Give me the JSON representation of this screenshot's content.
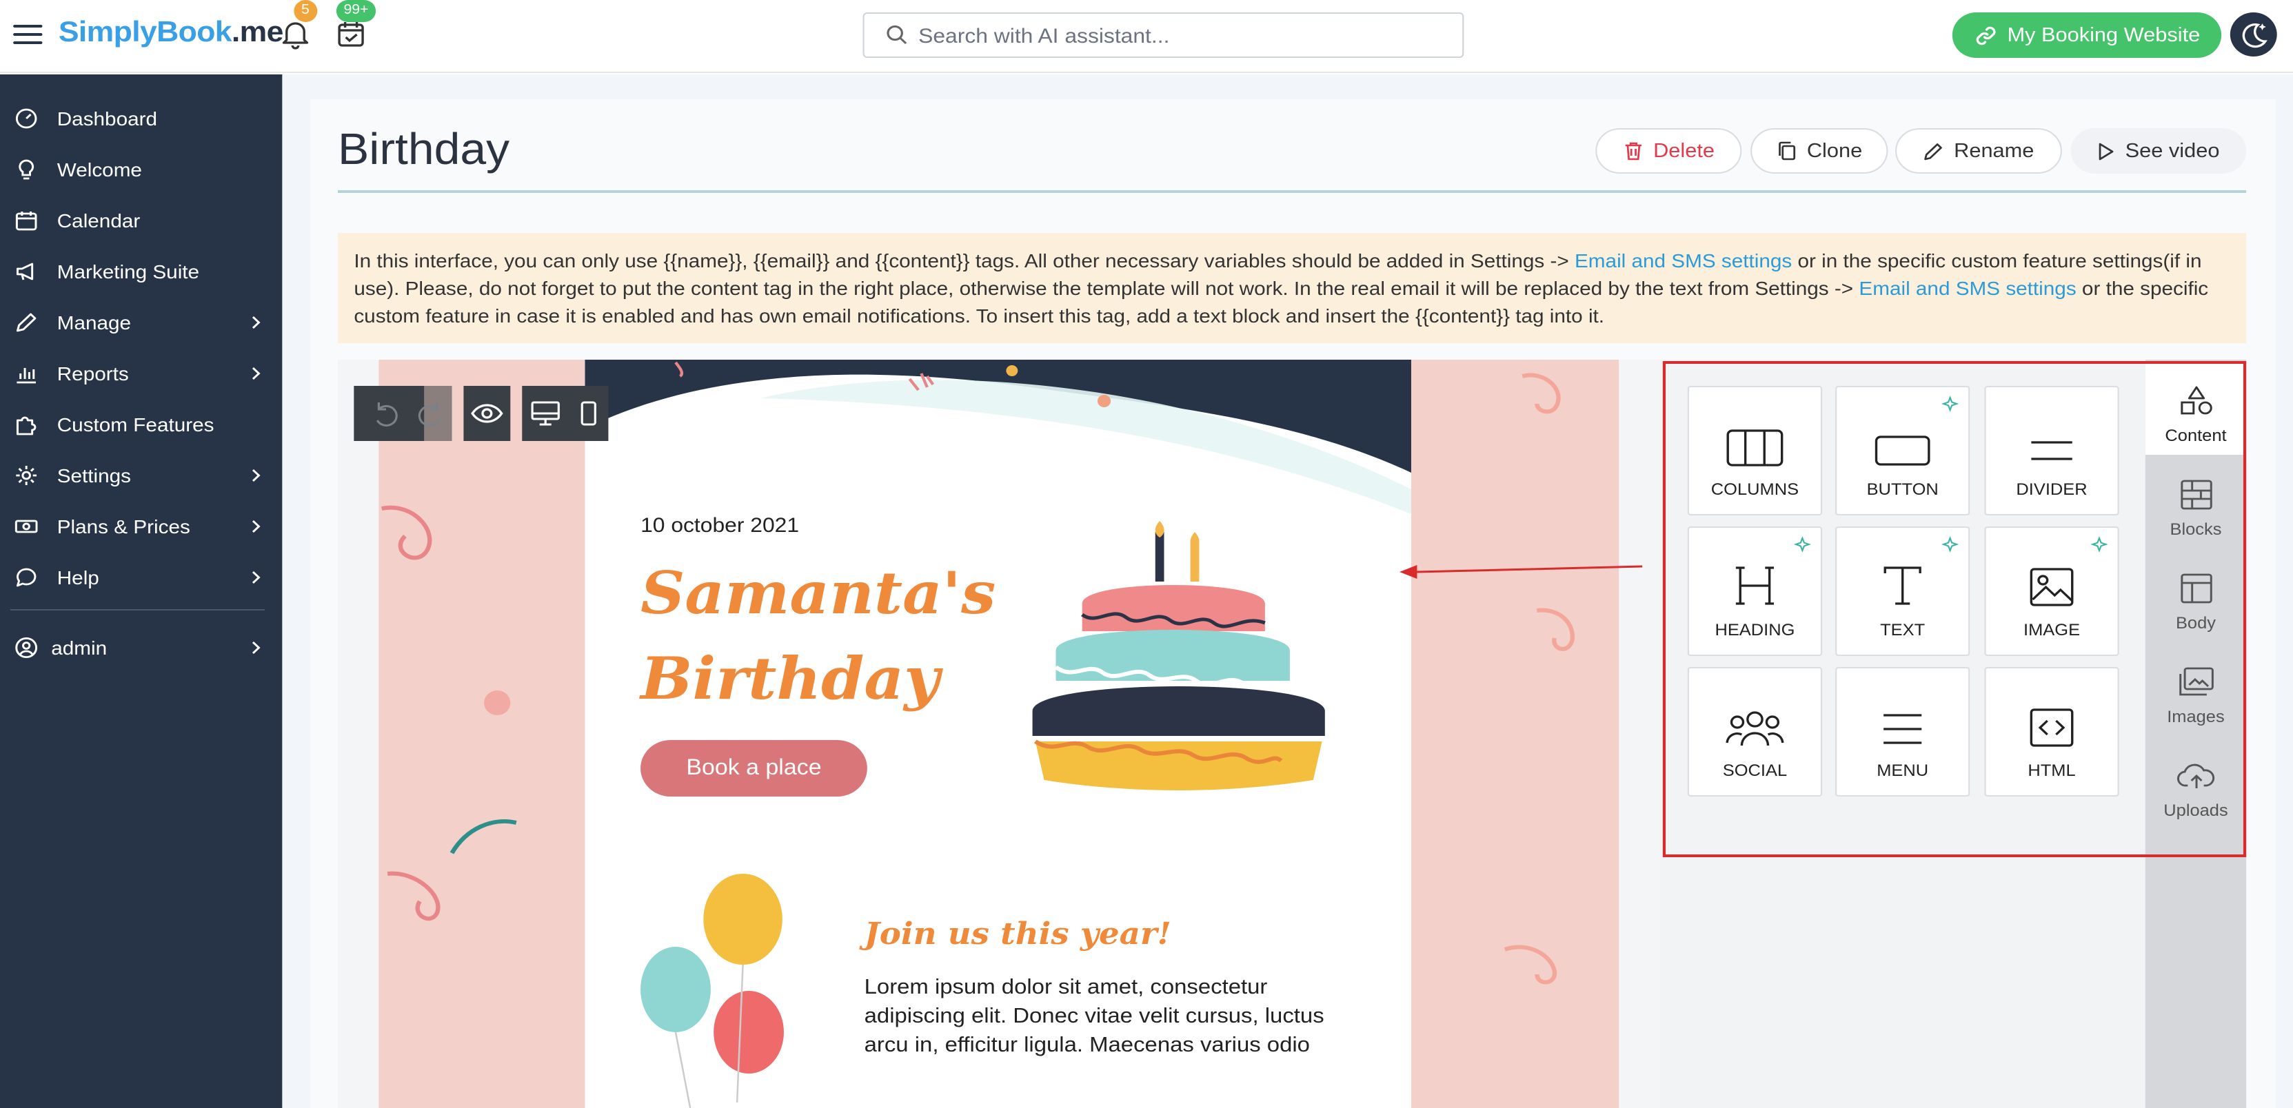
{
  "app": {
    "logo_main": "SimplyBook",
    "logo_suffix": ".me",
    "notifications_count": "5",
    "bookings_count": "99+",
    "search_placeholder": "Search with AI assistant...",
    "my_booking_website": "My Booking Website"
  },
  "sidebar": {
    "items": [
      {
        "label": "Dashboard",
        "icon": "dashboard-icon"
      },
      {
        "label": "Welcome",
        "icon": "bulb-icon"
      },
      {
        "label": "Calendar",
        "icon": "calendar-icon"
      },
      {
        "label": "Marketing Suite",
        "icon": "megaphone-icon"
      },
      {
        "label": "Manage",
        "icon": "pencil-icon"
      },
      {
        "label": "Reports",
        "icon": "bar-chart-icon"
      },
      {
        "label": "Custom Features",
        "icon": "puzzle-icon"
      },
      {
        "label": "Settings",
        "icon": "gear-icon"
      },
      {
        "label": "Plans & Prices",
        "icon": "money-icon"
      },
      {
        "label": "Help",
        "icon": "chat-icon"
      }
    ],
    "user": "admin"
  },
  "page": {
    "title": "Birthday",
    "actions": {
      "delete": "Delete",
      "clone": "Clone",
      "rename": "Rename",
      "video": "See video"
    },
    "info": {
      "p1": "In this interface, you can only use {{name}}, {{email}} and {{content}} tags. All other necessary variables should be added in Settings -> ",
      "link1": "Email and SMS settings",
      "p2": " or in the specific custom feature settings(if in use). Please, do not forget to put the content tag in the right place, otherwise the template will not work. In the real email it will be replaced by the text from Settings -> ",
      "link2": "Email and SMS settings",
      "p3": " or the specific custom feature in case it is enabled and has own email notifications. To insert this tag, add a text block and insert the {{content}} tag into it."
    }
  },
  "email": {
    "date": "10 october 2021",
    "heading_line1": "Samanta's",
    "heading_line2": "Birthday",
    "button": "Book a place",
    "join": "Join us this year!",
    "body": "Lorem ipsum dolor sit amet, consectetur adipiscing elit. Donec vitae velit cursus, luctus arcu in, efficitur ligula. Maecenas varius odio"
  },
  "builder": {
    "tools": [
      {
        "label": "COLUMNS",
        "ai": false
      },
      {
        "label": "BUTTON",
        "ai": true
      },
      {
        "label": "DIVIDER",
        "ai": false
      },
      {
        "label": "HEADING",
        "ai": true
      },
      {
        "label": "TEXT",
        "ai": true
      },
      {
        "label": "IMAGE",
        "ai": true
      },
      {
        "label": "SOCIAL",
        "ai": false
      },
      {
        "label": "MENU",
        "ai": false
      },
      {
        "label": "HTML",
        "ai": false
      }
    ],
    "tabs": [
      "Content",
      "Blocks",
      "Body",
      "Images",
      "Uploads"
    ],
    "active_tab": "Content"
  },
  "colors": {
    "sidebar": "#273447",
    "brand_green": "#45c36a",
    "accent_orange": "#ef8a3a",
    "highlight_red": "#d92b2b"
  }
}
